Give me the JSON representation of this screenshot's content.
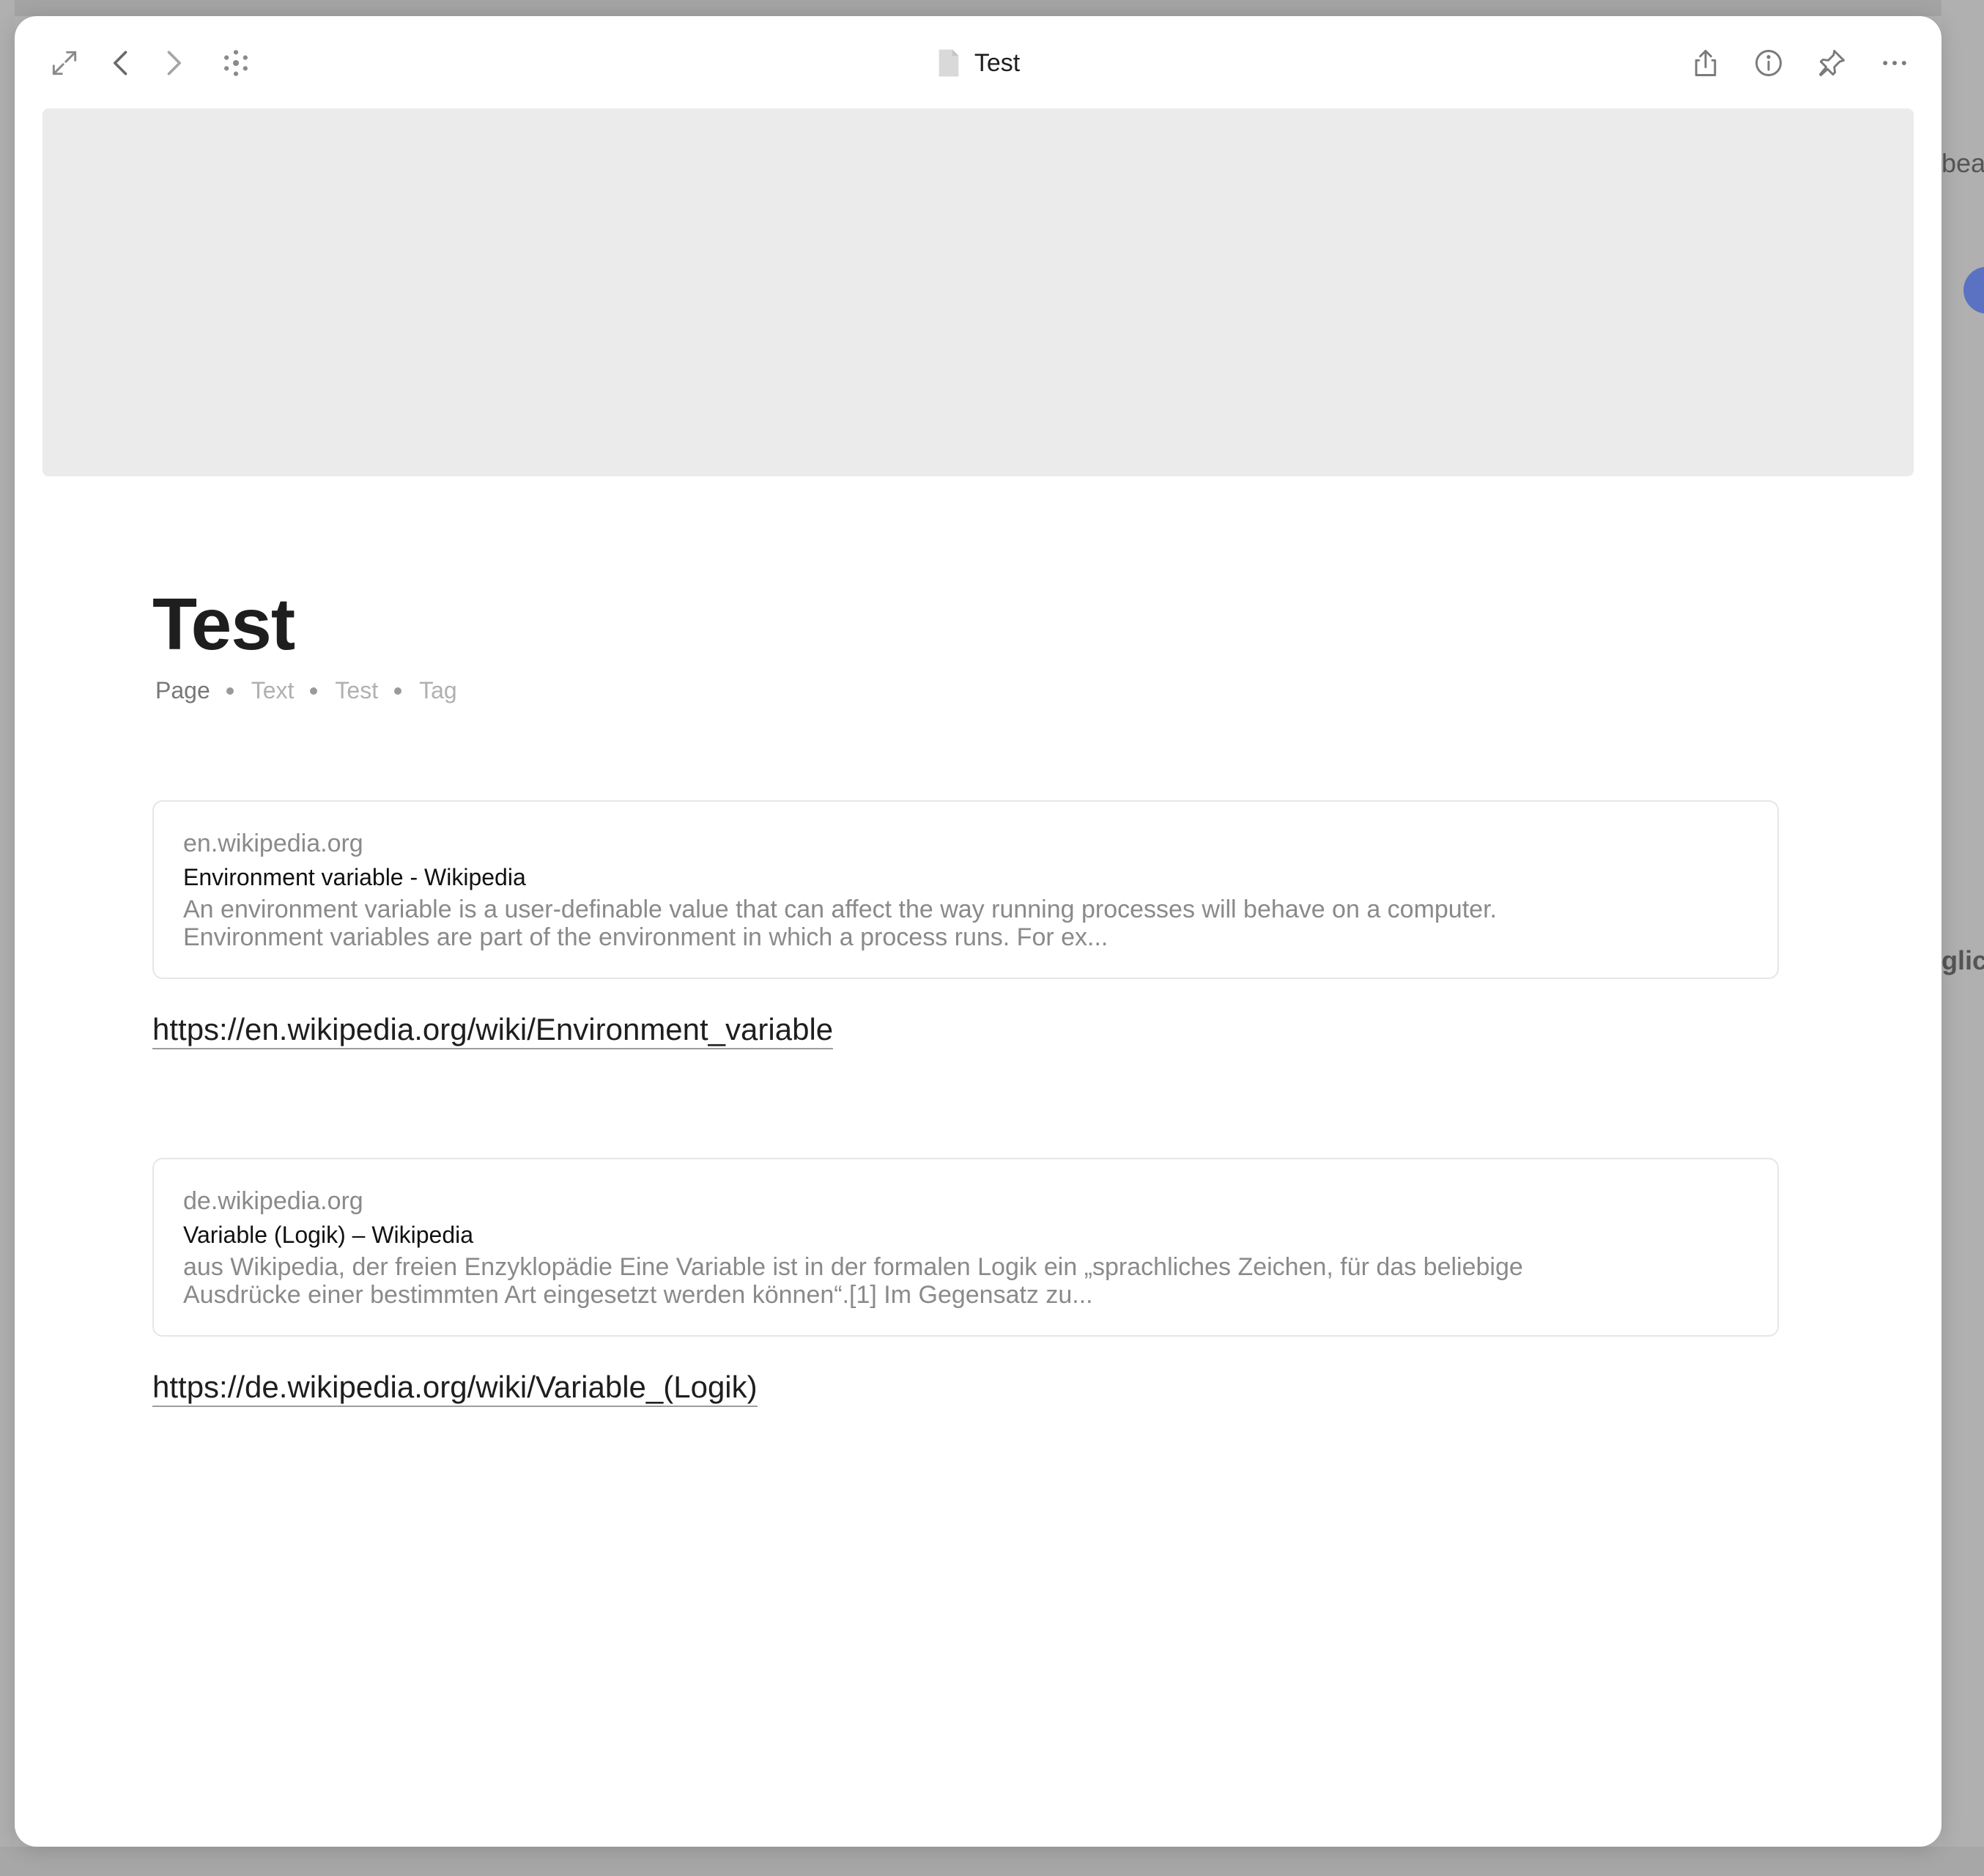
{
  "window": {
    "title": "Test",
    "toolbar": {
      "expand_icon": "expand-arrows-icon",
      "back_icon": "chevron-left-icon",
      "forward_icon": "chevron-right-icon",
      "graph_icon": "graph-dots-icon",
      "share_icon": "share-icon",
      "info_icon": "info-icon",
      "pin_icon": "pin-icon",
      "more_icon": "more-horizontal-icon"
    }
  },
  "page": {
    "title": "Test",
    "properties": {
      "type": "Page",
      "items": [
        "Text",
        "Test",
        "Tag"
      ]
    }
  },
  "bookmarks": [
    {
      "domain": "en.wikipedia.org",
      "title": "Environment variable - Wikipedia",
      "description_line1": "An environment variable is a user-definable value that can affect the way running processes will behave on a computer.",
      "description_line2": "Environment variables are part of the environment in which a process runs. For ex...",
      "url": "https://en.wikipedia.org/wiki/Environment_variable"
    },
    {
      "domain": "de.wikipedia.org",
      "title": "Variable (Logik) – Wikipedia",
      "description_line1": "aus Wikipedia, der freien Enzyklopädie Eine Variable ist in der formalen Logik ein „sprachliches Zeichen, für das beliebige",
      "description_line2": "Ausdrücke einer bestimmten Art eingesetzt werden können“.[1] Im Gegensatz zu...",
      "url": "https://de.wikipedia.org/wiki/Variable_(Logik)"
    }
  ],
  "background": {
    "fragments": [
      "bea",
      "glic",
      "g"
    ]
  },
  "colors": {
    "modal_bg": "#ffffff",
    "cover_bg": "#ebebeb",
    "backdrop": "#b3b3b3",
    "text_primary": "#1e1e1e",
    "text_muted": "#8a8a8a"
  }
}
